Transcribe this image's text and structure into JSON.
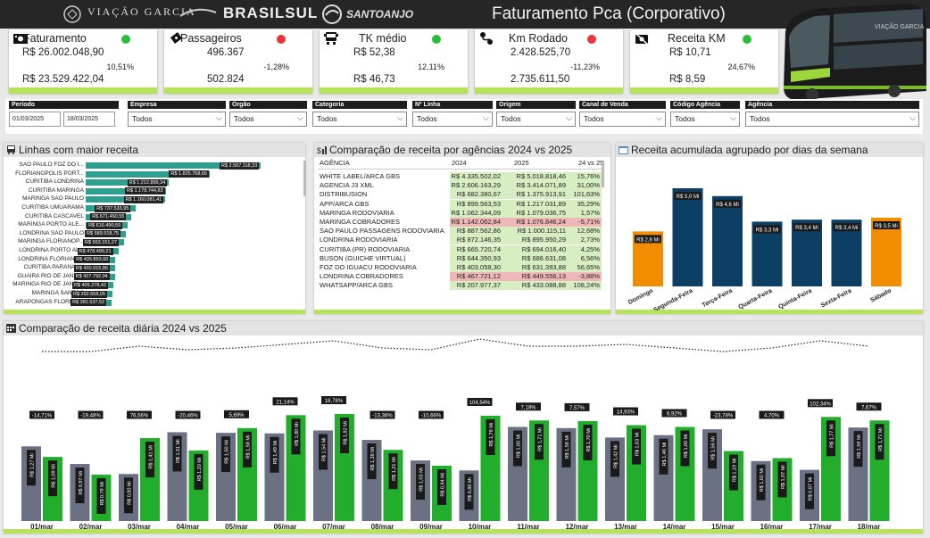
{
  "header": {
    "logo1": "VIAÇÃO GARCIA",
    "logo2": "BRASILSUL",
    "logo3": "SANTOANJO",
    "title": "Faturamento  Pca (Corporativo)"
  },
  "kpis": [
    {
      "title": "Faturamento",
      "icon": "money-icon",
      "status": "green",
      "v2025": "R$ 26.002.048,90",
      "v2024": "R$ 23.529.422,04",
      "pct": "10,51%"
    },
    {
      "title": "Passageiros",
      "icon": "ticket-icon",
      "status": "red",
      "v2025": "496.367",
      "v2024": "502.824",
      "pct": "-1,28%"
    },
    {
      "title": "TK médio",
      "icon": "bus-icon",
      "status": "green",
      "v2025": "R$ 52,38",
      "v2024": "R$ 46,73",
      "pct": "12,11%"
    },
    {
      "title": "Km Rodado",
      "icon": "route-icon",
      "status": "red",
      "v2025": "2.428.525,70",
      "v2024": "2.735.611,50",
      "pct": "-11,23%"
    },
    {
      "title": "Receita KM",
      "icon": "camera-off-icon",
      "status": "green",
      "v2025": "R$ 10,71",
      "v2024": "R$ 8,59",
      "pct": "24,67%"
    }
  ],
  "colors": {
    "green": "#2bbd3a",
    "red": "#e8343b",
    "teal": "#2e9e8f",
    "gray": "#6b7083",
    "bright_green": "#22ae2c",
    "navy": "#0c3f63",
    "orange": "#f28c00",
    "accent": "#b7e35a"
  },
  "filters": {
    "periodo": {
      "label": "Período",
      "start": "01/03/2025",
      "end": "18/03/2025"
    },
    "dropdowns": [
      {
        "label": "Empresa",
        "value": "Todos"
      },
      {
        "label": "Orgão",
        "value": "Todos"
      },
      {
        "label": "Categoria",
        "value": "Todos"
      },
      {
        "label": "Nº Linha",
        "value": "Todos"
      },
      {
        "label": "Origem",
        "value": "Todos"
      },
      {
        "label": "Canal de Venda",
        "value": "Todos"
      },
      {
        "label": "Código Agência",
        "value": "Todos"
      },
      {
        "label": "Agência",
        "value": "Todos"
      }
    ]
  },
  "linhas": {
    "title": "Linhas com maior receita",
    "items": [
      {
        "label": "SAO PAULO  FOZ DO I...",
        "value": 2567118.33,
        "text": "R$ 2.567.118,33"
      },
      {
        "label": "FLORIANOPOLIS  PORT...",
        "value": 1825768.65,
        "text": "R$ 1.825.768,65"
      },
      {
        "label": "CURITIBA  LONDRINA",
        "value": 1212899.34,
        "text": "R$ 1.212.899,34"
      },
      {
        "label": "CURITIBA  MARINGA",
        "value": 1178744.83,
        "text": "R$ 1.178.744,83"
      },
      {
        "label": "MARINGA  SAO PAULO",
        "value": 1160081.41,
        "text": "R$ 1.160.081,41"
      },
      {
        "label": "CURITIBA  UMUARAMA",
        "value": 737533.95,
        "text": "R$ 737.533,95"
      },
      {
        "label": "CURITIBA  CASCAVEL",
        "value": 671460.55,
        "text": "R$ 671.460,55"
      },
      {
        "label": "MARINGA  PORTO ALE...",
        "value": 616490.59,
        "text": "R$ 616.490,59"
      },
      {
        "label": "LONDRINA  SAO PAULO",
        "value": 589918.75,
        "text": "R$ 589.918,75"
      },
      {
        "label": "MARINGA  FLORIANOP...",
        "value": 563151.27,
        "text": "R$ 563.151,27"
      },
      {
        "label": "LONDRINA  PORTO AL...",
        "value": 478499.21,
        "text": "R$ 478.499,21"
      },
      {
        "label": "LONDRINA  FLORIANO...",
        "value": 435893.6,
        "text": "R$ 435.893,60"
      },
      {
        "label": "CURITIBA  PARANAVAI",
        "value": 430915.86,
        "text": "R$ 430.915,86"
      },
      {
        "label": "GUAIRA  RIO DE JANEI...",
        "value": 427792.04,
        "text": "R$ 427.792,04"
      },
      {
        "label": "MARINGA  RIO DE JANEI...",
        "value": 405278.42,
        "text": "R$ 405.278,42"
      },
      {
        "label": "MARINGA  SANTOS",
        "value": 392658.05,
        "text": "R$ 392.658,05"
      },
      {
        "label": "ARAPONGAS  FLORIAN...",
        "value": 381537.52,
        "text": "R$ 381.537,52"
      }
    ]
  },
  "agencias": {
    "title": "Comparação de receita por agências 2024 vs 2025",
    "headers": [
      "AGÊNCIA",
      "2024",
      "2025",
      "24 vs 25"
    ],
    "rows": [
      {
        "name": "WHITE LABEL/ARCA GBS",
        "v2024": "R$ 4.335.502,02",
        "v2025": "R$ 5.018.818,46",
        "pct": "15,76%",
        "neg": false
      },
      {
        "name": "AGENCIA J3 XML",
        "v2024": "R$ 2.606.163,29",
        "v2025": "R$ 3.414.071,89",
        "pct": "31,00%",
        "neg": false
      },
      {
        "name": "DISTRIBUSION",
        "v2024": "R$ 682.380,67",
        "v2025": "R$ 1.375.913,91",
        "pct": "101,63%",
        "neg": false
      },
      {
        "name": "APP/ARCA GBS",
        "v2024": "R$ 899.563,53",
        "v2025": "R$ 1.217.031,89",
        "pct": "35,29%",
        "neg": false
      },
      {
        "name": "MARINGA RODOVIARIA",
        "v2024": "R$ 1.062.344,09",
        "v2025": "R$ 1.079.036,75",
        "pct": "1,57%",
        "neg": false
      },
      {
        "name": "MARINGA COBRADORES",
        "v2024": "R$ 1.142.062,84",
        "v2025": "R$ 1.076.846,24",
        "pct": "-5,71%",
        "neg": true
      },
      {
        "name": "SAO PAULO PASSAGENS RODOVIARIA",
        "v2024": "R$ 887.562,86",
        "v2025": "R$ 1.000.115,11",
        "pct": "12,68%",
        "neg": false
      },
      {
        "name": "LONDRINA RODOVIARIA",
        "v2024": "R$ 872.146,35",
        "v2025": "R$ 895.950,29",
        "pct": "2,73%",
        "neg": false
      },
      {
        "name": "CURITIBA (PR) RODOVIARIA",
        "v2024": "R$ 665.720,74",
        "v2025": "R$ 694.016,40",
        "pct": "4,25%",
        "neg": false
      },
      {
        "name": "BUSON (GUICHE VIRTUAL)",
        "v2024": "R$ 644.350,93",
        "v2025": "R$ 686.631,08",
        "pct": "6,56%",
        "neg": false
      },
      {
        "name": "FOZ DO IGUACU RODOVIARIA",
        "v2024": "R$ 403.058,30",
        "v2025": "R$ 631.393,88",
        "pct": "56,65%",
        "neg": false
      },
      {
        "name": "LONDRINA COBRADORES",
        "v2024": "R$ 467.721,12",
        "v2025": "R$ 449.556,13",
        "pct": "-3,88%",
        "neg": true
      },
      {
        "name": "WHATSAPP/ARCA GBS",
        "v2024": "R$ 207.977,37",
        "v2025": "R$ 433.088,88",
        "pct": "108,24%",
        "neg": false
      }
    ]
  },
  "semana": {
    "title": "Receita acumulada agrupado por dias da semana",
    "days": [
      {
        "day": "Domingo",
        "value": 2.8,
        "text": "R$ 2,8 Mi",
        "color": "orange"
      },
      {
        "day": "Segunda-Feira",
        "value": 5.0,
        "text": "R$ 5,0 Mi",
        "color": "navy"
      },
      {
        "day": "Terça-Feira",
        "value": 4.6,
        "text": "R$ 4,6 Mi",
        "color": "navy"
      },
      {
        "day": "Quarta-Feira",
        "value": 3.3,
        "text": "R$ 3,3 Mi",
        "color": "navy"
      },
      {
        "day": "Quinta-Feira",
        "value": 3.4,
        "text": "R$ 3,4 Mi",
        "color": "navy"
      },
      {
        "day": "Sexta-Feira",
        "value": 3.4,
        "text": "R$ 3,4 Mi",
        "color": "navy"
      },
      {
        "day": "Sábado",
        "value": 3.5,
        "text": "R$ 3,5 Mi",
        "color": "orange"
      }
    ]
  },
  "chart_data": {
    "type": "bar",
    "title": "Comparação de receita diária 2024 vs 2025",
    "categories": [
      "01/mar",
      "02/mar",
      "03/mar",
      "04/mar",
      "05/mar",
      "06/mar",
      "07/mar",
      "08/mar",
      "09/mar",
      "10/mar",
      "11/mar",
      "12/mar",
      "13/mar",
      "14/mar",
      "15/mar",
      "16/mar",
      "17/mar",
      "18/mar"
    ],
    "series": [
      {
        "values": [
          1.27,
          0.97,
          0.8,
          1.51,
          1.5,
          1.49,
          1.54,
          1.38,
          1.03,
          0.86,
          1.6,
          1.58,
          1.42,
          1.46,
          1.56,
          1.02,
          0.87,
          1.59
        ],
        "labels": [
          "R$ 1,27 Mi",
          "R$ 0,97 Mi",
          "R$ 0,80 Mi",
          "R$ 1,51 Mi",
          "R$ 1,50 Mi",
          "R$ 1,49 Mi",
          "R$ 1,54 Mi",
          "R$ 1,38 Mi",
          "R$ 1,03 Mi",
          "R$ 0,86 Mi",
          "R$ 1,60 Mi",
          "R$ 1,58 Mi",
          "R$ 1,42 Mi",
          "R$ 1,46 Mi",
          "R$ 1,56 Mi",
          "R$ 1,02 Mi",
          "R$ 0,87 Mi",
          "R$ 1,59 Mi"
        ]
      },
      {
        "values": [
          1.09,
          0.79,
          1.41,
          1.2,
          1.58,
          1.8,
          1.82,
          1.21,
          0.94,
          1.79,
          1.71,
          1.7,
          1.63,
          1.6,
          1.19,
          1.07,
          1.77,
          1.71
        ],
        "labels": [
          "R$ 1,09 Mi",
          "R$ 0,79 Mi",
          "R$ 1,41 Mi",
          "R$ 1,20 Mi",
          "R$ 1,58 Mi",
          "R$ 1,80 Mi",
          "R$ 1,82 Mi",
          "R$ 1,21 Mi",
          "R$ 0,94 Mi",
          "R$ 1,79 Mi",
          "R$ 1,71 Mi",
          "R$ 1,70 Mi",
          "R$ 1,63 Mi",
          "R$ 1,60 Mi",
          "R$ 1,19 Mi",
          "R$ 1,07 Mi",
          "R$ 1,77 Mi",
          "R$ 1,71 Mi"
        ]
      }
    ],
    "variation": [
      "-14,71%",
      "-19,48%",
      "76,56%",
      "-20,46%",
      "5,69%",
      "21,14%",
      "18,78%",
      "-13,36%",
      "-10,66%",
      "104,54%",
      "7,18%",
      "7,57%",
      "14,93%",
      "6,92%",
      "-23,78%",
      "4,70%",
      "102,34%",
      "7,67%"
    ],
    "ylim": [
      0,
      2.0
    ]
  }
}
